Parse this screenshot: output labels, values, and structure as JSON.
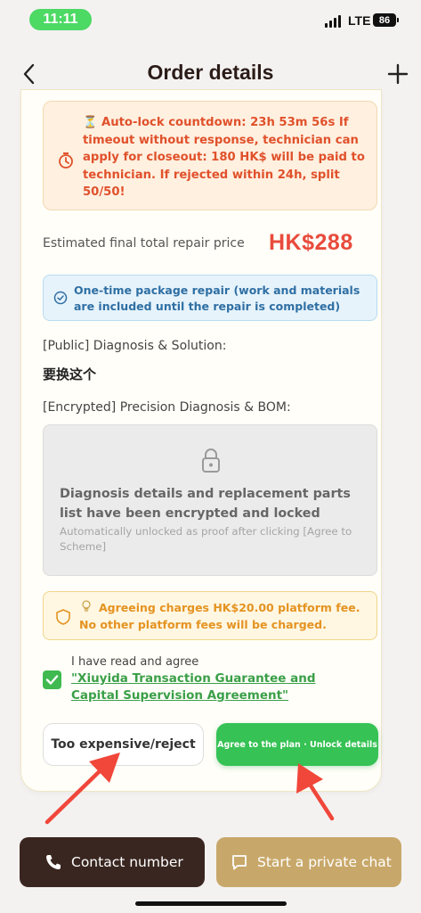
{
  "status_bar": {
    "time": "11:11",
    "network": "LTE",
    "battery": "86"
  },
  "nav": {
    "title": "Order details"
  },
  "warning": {
    "text": "⏳ Auto-lock countdown: 23h 53m 56s If timeout without response, technician can apply for closeout: 180 HK$ will be paid to technician. If rejected within 24h, split 50/50!"
  },
  "price": {
    "label": "Estimated final total repair price",
    "value": "HK$288"
  },
  "info": {
    "text": "One-time package repair (work and materials are included until the repair is completed)"
  },
  "diagnosis": {
    "public_label": "[Public] Diagnosis & Solution:",
    "public_text": "要换这个",
    "encrypted_label": "[Encrypted] Precision Diagnosis & BOM:"
  },
  "locked": {
    "title": "Diagnosis details and replacement parts list have been encrypted and locked",
    "subtitle": "Automatically unlocked as proof after clicking [Agree to Scheme]"
  },
  "fee": {
    "text": "Agreeing charges HK$20.00 platform fee. No other platform fees will be charged."
  },
  "agreement": {
    "label": "I have read and agree",
    "link": "\"Xiuyida Transaction Guarantee and Capital Supervision Agreement\"",
    "checked": true
  },
  "actions": {
    "reject_label": "Too expensive/reject",
    "agree_label": "Agree to the plan · Unlock details"
  },
  "bottom": {
    "contact_label": "Contact number",
    "chat_label": "Start a private chat"
  },
  "colors": {
    "accent_green": "#36c254",
    "price_red": "#e84b3c",
    "warning_orange": "#e0512b",
    "dark_brown": "#3a2620",
    "gold": "#c8a86a",
    "annotation_red": "#f0473a"
  }
}
